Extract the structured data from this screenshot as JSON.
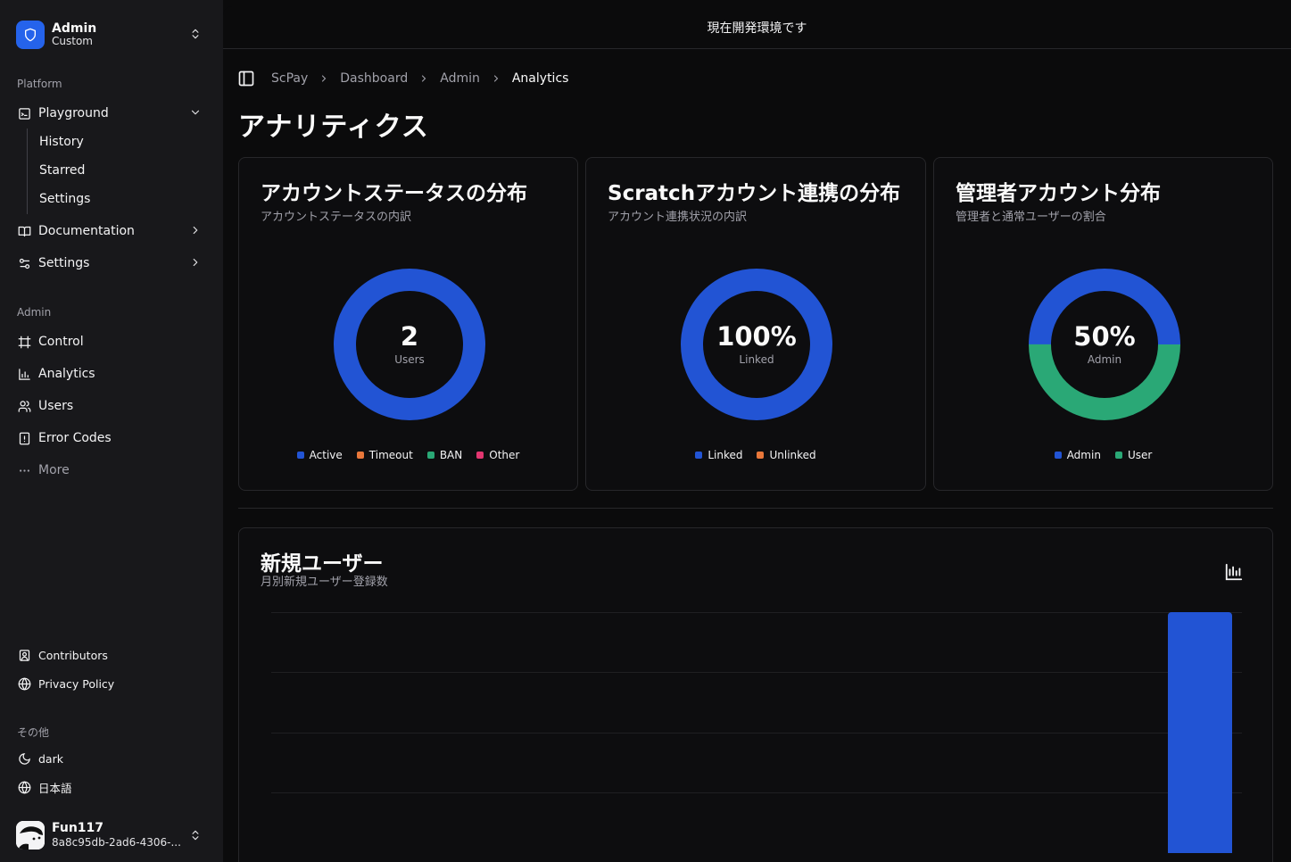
{
  "sidebar": {
    "team": {
      "name": "Admin",
      "plan": "Custom"
    },
    "platform_label": "Platform",
    "platform_items": [
      {
        "label": "Playground",
        "icon": "terminal-icon"
      },
      {
        "label": "Documentation",
        "icon": "book-icon"
      },
      {
        "label": "Settings",
        "icon": "settings-icon"
      }
    ],
    "playground_sub": [
      "History",
      "Starred",
      "Settings"
    ],
    "admin_label": "Admin",
    "admin_items": [
      {
        "label": "Control",
        "icon": "frame-icon"
      },
      {
        "label": "Analytics",
        "icon": "bar-chart-icon"
      },
      {
        "label": "Users",
        "icon": "users-icon"
      },
      {
        "label": "Error Codes",
        "icon": "file-alert-icon"
      },
      {
        "label": "More",
        "icon": "more-icon"
      }
    ],
    "footer_links": [
      {
        "label": "Contributors",
        "icon": "contact-icon"
      },
      {
        "label": "Privacy Policy",
        "icon": "globe-lock-icon"
      }
    ],
    "other_label": "その他",
    "other_items": [
      {
        "label": "dark",
        "icon": "moon-icon"
      },
      {
        "label": "日本語",
        "icon": "globe-icon"
      }
    ],
    "user": {
      "name": "Fun117",
      "id": "8a8c95db-2ad6-4306-..."
    }
  },
  "banner": "現在開発環境です",
  "breadcrumb": [
    "ScPay",
    "Dashboard",
    "Admin",
    "Analytics"
  ],
  "page_title": "アナリティクス",
  "cards": [
    {
      "title": "アカウントステータスの分布",
      "subtitle": "アカウントステータスの内訳",
      "center_value": "2",
      "center_label": "Users",
      "legend": [
        {
          "label": "Active",
          "color": "#2254d4"
        },
        {
          "label": "Timeout",
          "color": "#e8773a"
        },
        {
          "label": "BAN",
          "color": "#2aa876"
        },
        {
          "label": "Other",
          "color": "#e23670"
        }
      ]
    },
    {
      "title": "Scratchアカウント連携の分布",
      "subtitle": "アカウント連携状況の内訳",
      "center_value": "100%",
      "center_label": "Linked",
      "legend": [
        {
          "label": "Linked",
          "color": "#2254d4"
        },
        {
          "label": "Unlinked",
          "color": "#e8773a"
        }
      ]
    },
    {
      "title": "管理者アカウント分布",
      "subtitle": "管理者と通常ユーザーの割合",
      "center_value": "50%",
      "center_label": "Admin",
      "legend": [
        {
          "label": "Admin",
          "color": "#2254d4"
        },
        {
          "label": "User",
          "color": "#2aa876"
        }
      ]
    }
  ],
  "chart_data": [
    {
      "type": "pie",
      "categories": [
        "Active",
        "Timeout",
        "BAN",
        "Other"
      ],
      "values": [
        2,
        0,
        0,
        0
      ]
    },
    {
      "type": "pie",
      "categories": [
        "Linked",
        "Unlinked"
      ],
      "values": [
        100,
        0
      ]
    },
    {
      "type": "pie",
      "categories": [
        "Admin",
        "User"
      ],
      "values": [
        50,
        50
      ]
    },
    {
      "type": "bar",
      "title": "新規ユーザー",
      "subtitle": "月別新規ユーザー登録数",
      "values": [
        2
      ],
      "colors": [
        "#2254d4"
      ]
    }
  ]
}
